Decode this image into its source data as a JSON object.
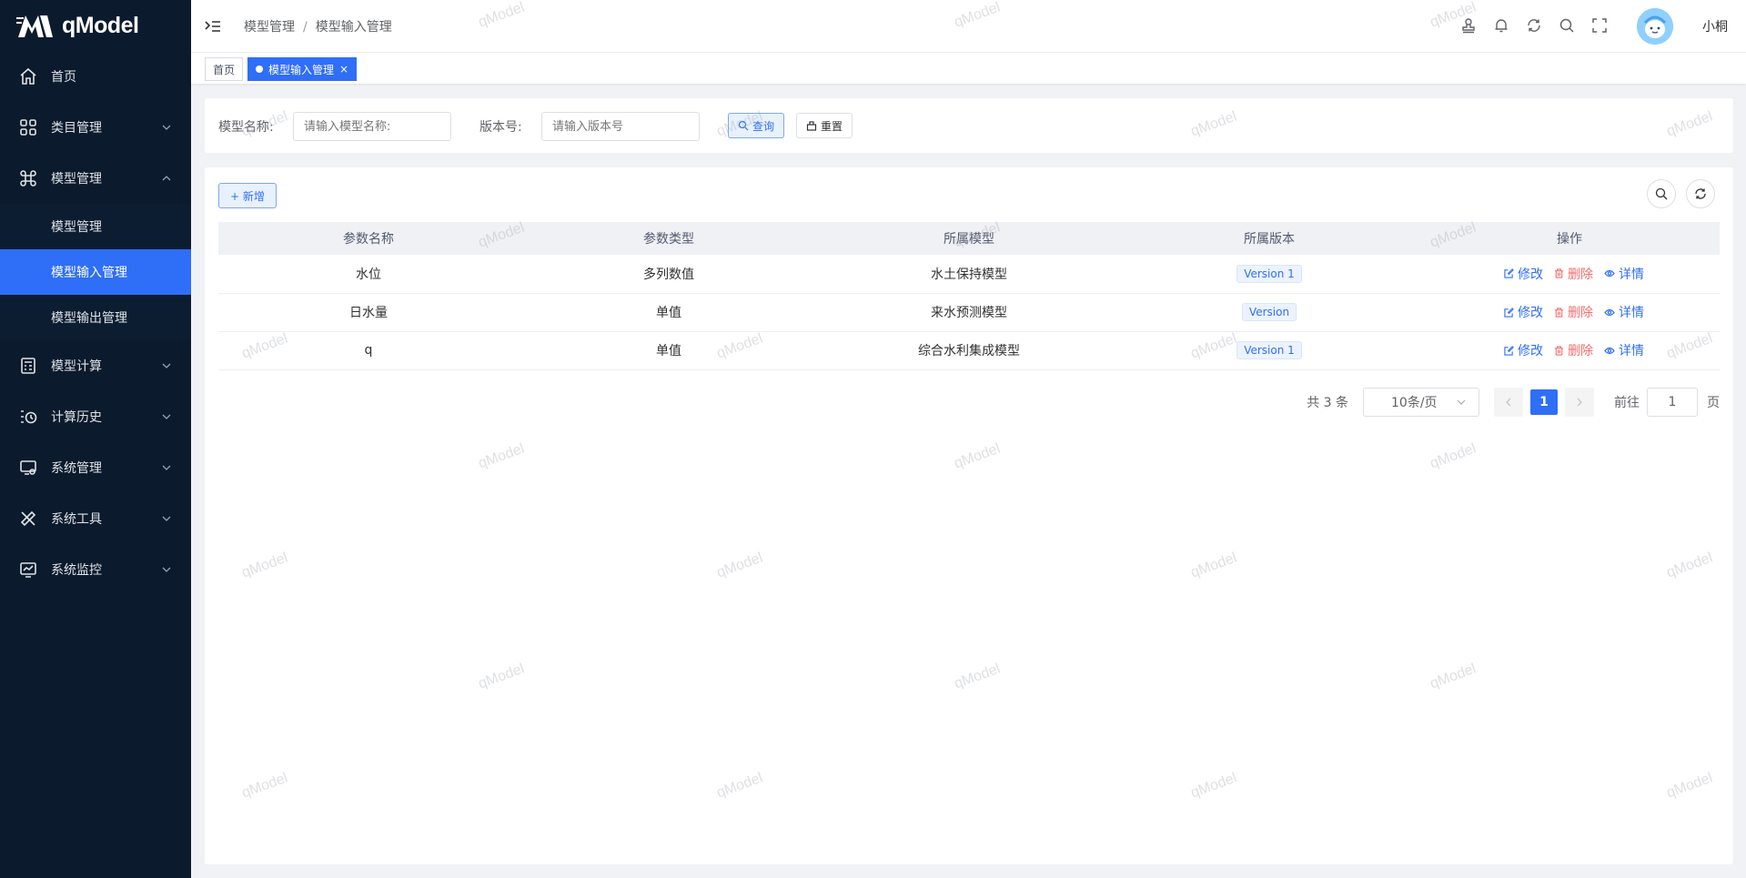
{
  "app": {
    "logo_text": "qModel",
    "username": "小桐"
  },
  "sidebar": {
    "items": [
      {
        "label": "首页",
        "icon": "home-icon"
      },
      {
        "label": "类目管理",
        "icon": "grid-icon"
      },
      {
        "label": "模型管理",
        "icon": "command-icon",
        "expanded": true,
        "children": [
          {
            "label": "模型管理"
          },
          {
            "label": "模型输入管理",
            "active": true
          },
          {
            "label": "模型输出管理"
          }
        ]
      },
      {
        "label": "模型计算",
        "icon": "calculator-icon"
      },
      {
        "label": "计算历史",
        "icon": "history-icon"
      },
      {
        "label": "系统管理",
        "icon": "monitor-settings-icon"
      },
      {
        "label": "系统工具",
        "icon": "tools-icon"
      },
      {
        "label": "系统监控",
        "icon": "monitor-chart-icon"
      }
    ]
  },
  "header": {
    "breadcrumb": [
      "模型管理",
      "模型输入管理"
    ],
    "breadcrumb_sep": "/"
  },
  "tags": [
    {
      "label": "首页",
      "active": false
    },
    {
      "label": "模型输入管理",
      "active": true,
      "close": "×"
    }
  ],
  "search": {
    "name_label": "模型名称:",
    "name_placeholder": "请输入模型名称:",
    "version_label": "版本号:",
    "version_placeholder": "请输入版本号",
    "query_label": "查询",
    "reset_label": "重置"
  },
  "toolbar": {
    "add_label": "+ 新增"
  },
  "table": {
    "columns": [
      "参数名称",
      "参数类型",
      "所属模型",
      "所属版本",
      "操作"
    ],
    "rows": [
      {
        "name": "水位",
        "type": "多列数值",
        "model": "水土保持模型",
        "version": "Version 1"
      },
      {
        "name": "日水量",
        "type": "单值",
        "model": "来水预测模型",
        "version": "Version"
      },
      {
        "name": "q",
        "type": "单值",
        "model": "综合水利集成模型",
        "version": "Version 1"
      }
    ],
    "ops": {
      "edit": "修改",
      "delete": "删除",
      "detail": "详情"
    }
  },
  "pagination": {
    "total_text": "共 3 条",
    "page_size": "10条/页",
    "current_page": "1",
    "goto_label": "前往",
    "goto_value": "1",
    "page_suffix": "页"
  },
  "watermark": "qModel",
  "colors": {
    "sidebar_bg": "#0b1a2c",
    "primary": "#2f6ef7",
    "danger": "#f56c6c"
  }
}
